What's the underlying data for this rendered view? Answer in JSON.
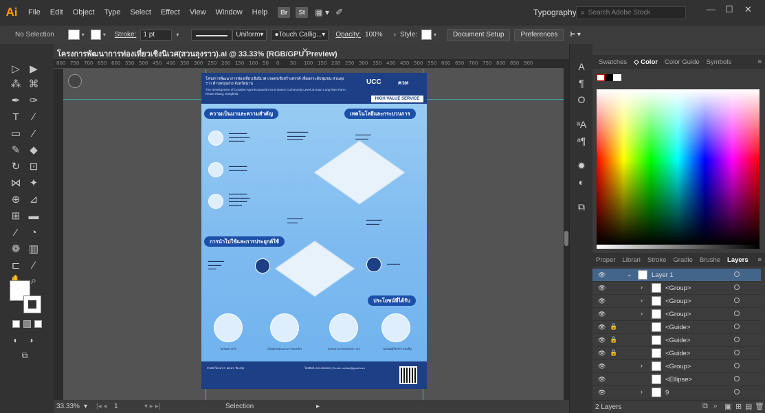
{
  "app": {
    "logo": "Ai",
    "menus": [
      "File",
      "Edit",
      "Object",
      "Type",
      "Select",
      "Effect",
      "View",
      "Window",
      "Help"
    ],
    "bridge_btn": "Br",
    "stock_btn": "St",
    "workspace": "Typography",
    "search_placeholder": "Search Adobe Stock"
  },
  "control_bar": {
    "selection": "No Selection",
    "stroke_label": "Stroke:",
    "stroke_weight": "1 pt",
    "profile": "Uniform",
    "brush": "Touch Callig...",
    "opacity_label": "Opacity:",
    "opacity": "100%",
    "style_label": "Style:",
    "document_setup": "Document Setup",
    "preferences": "Preferences"
  },
  "document": {
    "tab_title": "โครงการพัฒนาการท่องเที่ยวเชิงนิเวศ(สวนลุงราว).ai @ 33.33% (RGB/GPU Preview)",
    "ruler_ticks": [
      "800",
      "750",
      "700",
      "650",
      "600",
      "550",
      "500",
      "450",
      "400",
      "350",
      "300",
      "250",
      "200",
      "150",
      "100",
      "50",
      "0",
      "50",
      "100",
      "150",
      "200",
      "250",
      "300",
      "350",
      "400",
      "450",
      "500",
      "550",
      "600",
      "650",
      "700",
      "750",
      "800",
      "850",
      "900"
    ]
  },
  "artboard": {
    "title_th": "โครงการพัฒนาการท่องเที่ยวเชิงนิเวศ เกษตรเชิงสร้างสรรค์ เพื่อยกระดับชุมชน สวนลุงราว ตำบลขุนฝาง จังหวัดน่าน",
    "title_en": "The Development of Creative Agro-Ecotourism to Enhance Community Level at Suan Lung Ram Farm, Khuan Niang, Songkhla",
    "logo_left": "UCC",
    "logo_right": "ควท",
    "hvs": "HIGH VALUE SERVICE",
    "section1": "ความเป็นมาและความสำคัญ",
    "section2": "เทคโนโลยีและกระบวนการ",
    "section3": "การนำไปใช้และการประยุกต์ใช้",
    "section4": "ประโยชน์ที่ได้รับ",
    "caption1": "ชุมชนมีรายได้",
    "caption2": "เป็นชุมชนต้นแบบการท่องเที่ยว",
    "caption3": "ชุมชนสามารถต่อยอดความรู้",
    "caption4": "ชุมชนมีผู้ใช้บริการเพิ่มขึ้น",
    "footer_left": "หัวหน้าโครงการ: ผศ.ดร. ชื่อ-สกุล",
    "footer_right": "โทรศัพท์: 000-0000000 | E-mail: contact@gmail.com"
  },
  "status_bar": {
    "zoom": "33.33%",
    "page": "1",
    "tool": "Selection"
  },
  "color_panel": {
    "tabs": [
      "Swatches",
      "Color",
      "Color Guide",
      "Symbols"
    ],
    "active_tab": "Color"
  },
  "layers_panel": {
    "tabs": [
      "Proper",
      "Librari",
      "Stroke",
      "Gradie",
      "Brushe",
      "Layers"
    ],
    "active_tab": "Layers",
    "rows": [
      {
        "name": "Layer 1",
        "selected": true
      },
      {
        "name": "<Group>",
        "selected": false
      },
      {
        "name": "<Group>",
        "selected": false
      },
      {
        "name": "<Group>",
        "selected": false
      },
      {
        "name": "<Guide>",
        "selected": false
      },
      {
        "name": "<Guide>",
        "selected": false
      },
      {
        "name": "<Guide>",
        "selected": false
      },
      {
        "name": "<Group>",
        "selected": false
      },
      {
        "name": "<Ellipse>",
        "selected": false
      },
      {
        "name": "9",
        "selected": false
      }
    ],
    "footer_count": "2 Layers"
  },
  "colors": {
    "ui_dark": "#323232",
    "ui_mid": "#3c3c3c",
    "accent": "#44658a",
    "ai_orange": "#ff9a00",
    "poster_blue": "#1d3f85"
  }
}
